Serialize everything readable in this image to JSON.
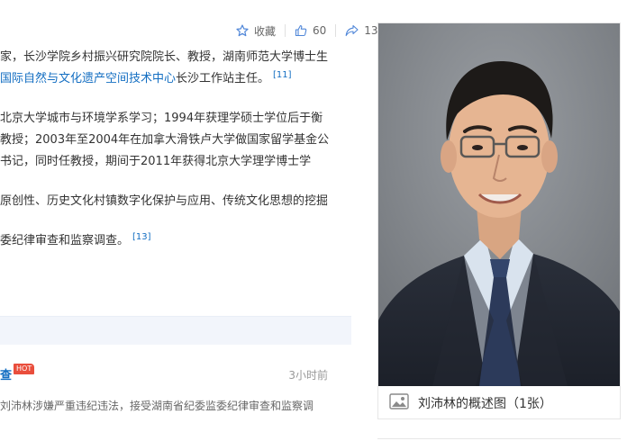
{
  "toolbar": {
    "favorite_label": "收藏",
    "like_count": "60",
    "share_count": "13"
  },
  "article": {
    "p1": {
      "line1": "家，长沙学院乡村振兴研究院院长、教授，湖南师范大学博士生",
      "line2_link": "联合国教科文组织国际自然与文化遗产空间技术中心",
      "line2_link_visible": "国际自然与文化遗产空间技术中心",
      "line2_tail": "长沙工作站主任。",
      "cite": "[11]"
    },
    "p2": {
      "line1": "北京大学城市与环境学系学习；1994年获理学硕士学位后于衡",
      "line2": "教授；2003年至2004年在加拿大滑铁卢大学做国家留学基金公",
      "line3": "书记，同时任教授，期间于2011年获得北京大学理学博士学"
    },
    "p3": {
      "line1": "原创性、历史文化村镇数字化保护与应用、传统文化思想的挖掘"
    },
    "p4": {
      "line1": "委纪律审查和监察调查。",
      "cite": "[13]"
    }
  },
  "news": {
    "title": "查",
    "hot_badge": "HOT",
    "time": "3小时前",
    "summary": "刘沛林涉嫌严重违纪违法，接受湖南省纪委监委纪律审查和监察调"
  },
  "picture": {
    "caption": "刘沛林的概述图（1张）"
  }
}
